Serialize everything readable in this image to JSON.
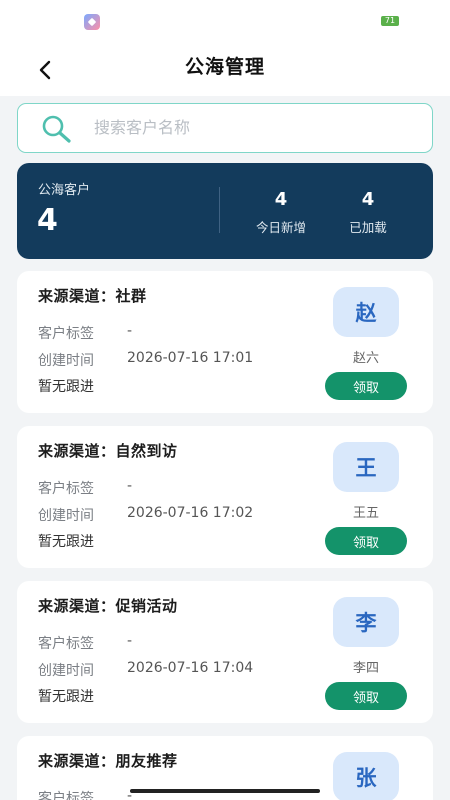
{
  "status_bar": {
    "battery": "71"
  },
  "header": {
    "title": "公海管理"
  },
  "search": {
    "placeholder": "搜索客户名称"
  },
  "summary": {
    "label": "公海客户",
    "count": "4",
    "stats": [
      {
        "value": "4",
        "label": "今日新增"
      },
      {
        "value": "4",
        "label": "已加载"
      }
    ]
  },
  "labels": {
    "tag": "客户标签",
    "created": "创建时间",
    "claim": "领取"
  },
  "customers": [
    {
      "title": "来源渠道：社群",
      "tag": "-",
      "created": "2026-07-16 17:01",
      "follow": "暂无跟进",
      "avatar": "赵",
      "name": "赵六"
    },
    {
      "title": "来源渠道：自然到访",
      "tag": "-",
      "created": "2026-07-16 17:02",
      "follow": "暂无跟进",
      "avatar": "王",
      "name": "王五"
    },
    {
      "title": "来源渠道：促销活动",
      "tag": "-",
      "created": "2026-07-16 17:04",
      "follow": "暂无跟进",
      "avatar": "李",
      "name": "李四"
    },
    {
      "title": "来源渠道：朋友推荐",
      "tag": "-",
      "created": "",
      "follow": "",
      "avatar": "张",
      "name": ""
    }
  ]
}
